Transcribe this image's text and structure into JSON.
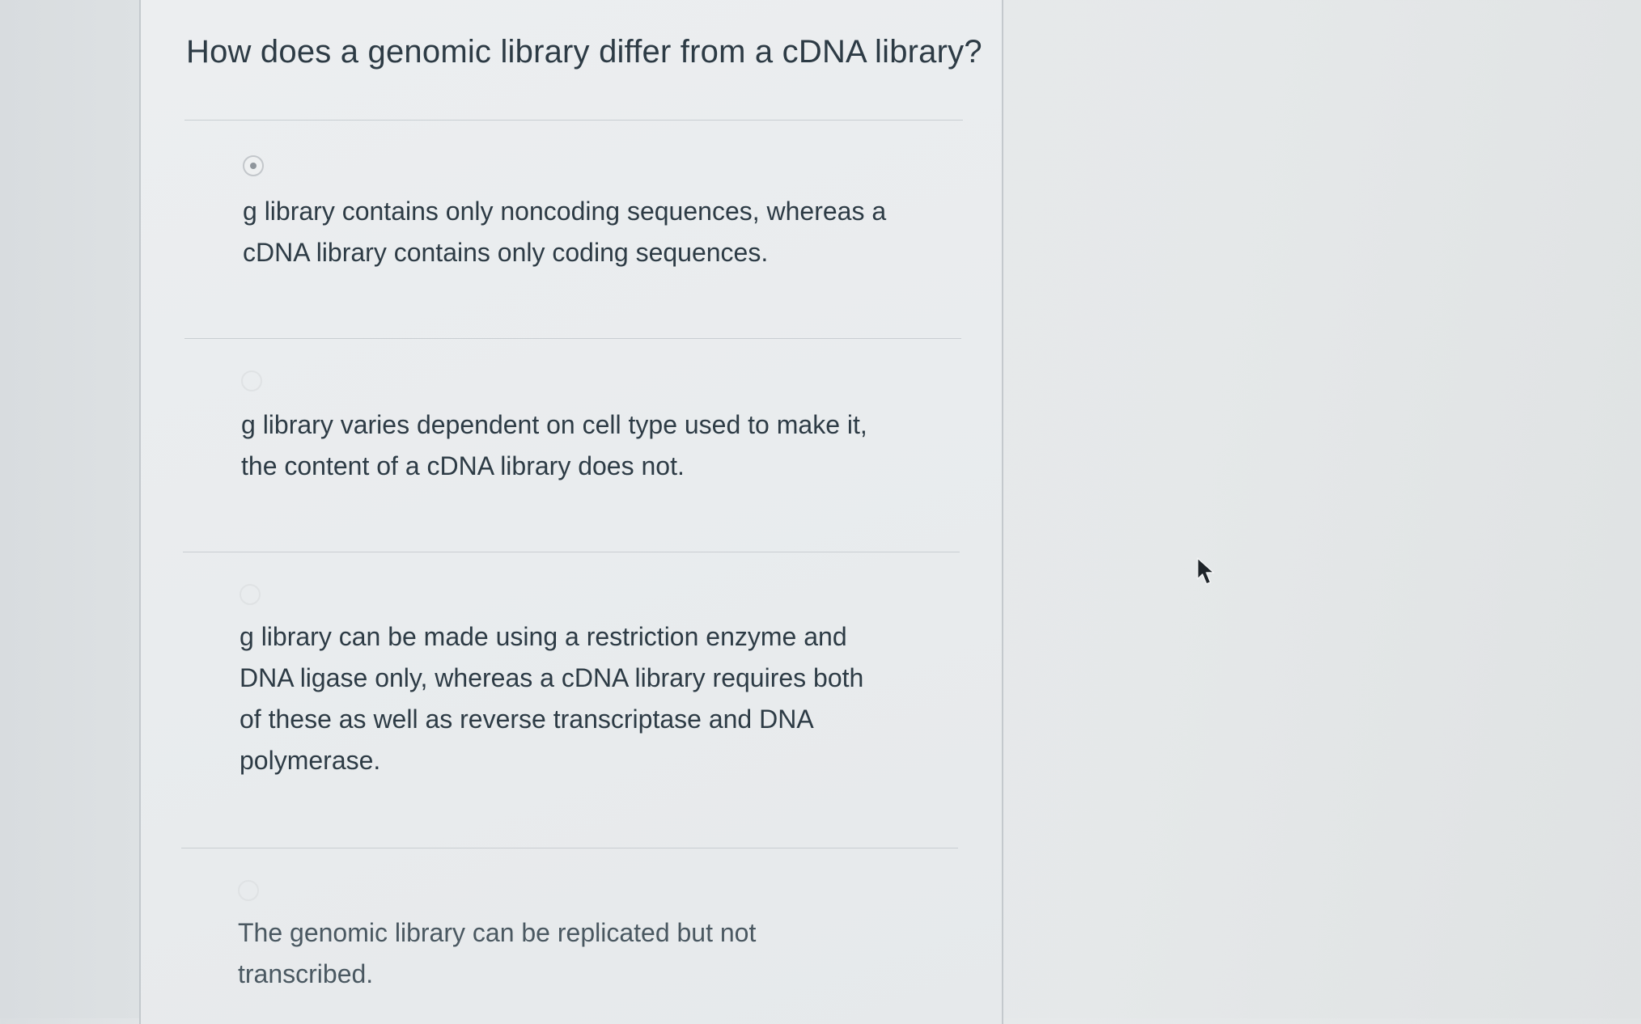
{
  "question": {
    "text": "How does a genomic library differ from a cDNA library?"
  },
  "answers": [
    {
      "line1": "g library contains only noncoding sequences, whereas a",
      "line2": "cDNA library contains only coding sequences.",
      "selected": true
    },
    {
      "line1": "g library varies dependent on cell type used to make it,",
      "line2": "the content of a cDNA library does not.",
      "selected": false
    },
    {
      "line1": "g library can be made using a restriction enzyme and",
      "line2": "DNA ligase only, whereas a cDNA library requires both",
      "line3": "of these as well as reverse transcriptase and DNA",
      "line4": "polymerase.",
      "selected": false
    },
    {
      "line1": "The genomic library can be replicated but not",
      "line2": "transcribed.",
      "selected": false
    }
  ],
  "cursor": {
    "icon": "mouse-pointer-icon"
  }
}
